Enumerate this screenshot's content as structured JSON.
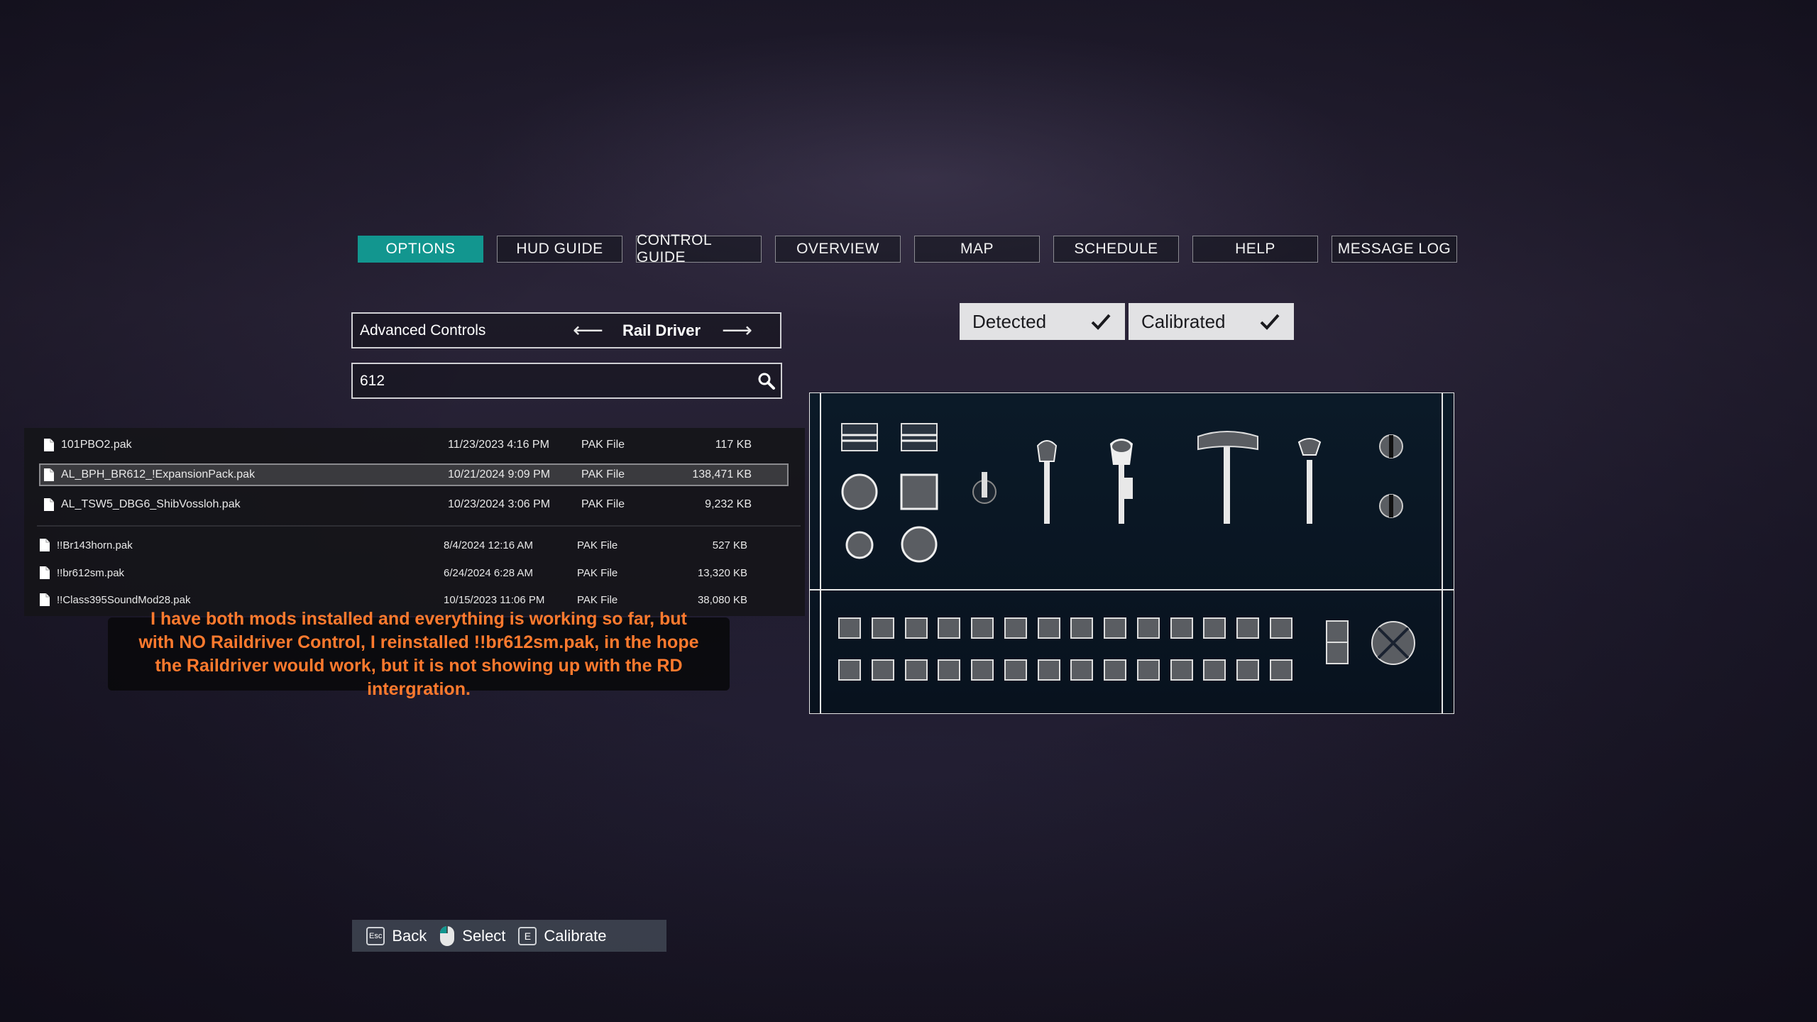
{
  "nav": {
    "tabs": [
      {
        "label": "OPTIONS",
        "active": true
      },
      {
        "label": "HUD GUIDE",
        "active": false
      },
      {
        "label": "CONTROL GUIDE",
        "active": false
      },
      {
        "label": "OVERVIEW",
        "active": false
      },
      {
        "label": "MAP",
        "active": false
      },
      {
        "label": "SCHEDULE",
        "active": false
      },
      {
        "label": "HELP",
        "active": false
      },
      {
        "label": "MESSAGE LOG",
        "active": false
      }
    ]
  },
  "selector": {
    "category": "Advanced Controls",
    "left_arrow": "⟵",
    "device": "Rail Driver",
    "right_arrow": "⟶"
  },
  "search": {
    "value": "612"
  },
  "status": {
    "detected": "Detected",
    "calibrated": "Calibrated"
  },
  "files": {
    "rows": [
      {
        "name": "101PBO2.pak",
        "date": "11/23/2023 4:16 PM",
        "type": "PAK File",
        "size": "117 KB"
      },
      {
        "name": "AL_BPH_BR612_!ExpansionPack.pak",
        "date": "10/21/2024 9:09 PM",
        "type": "PAK File",
        "size": "138,471 KB"
      },
      {
        "name": "AL_TSW5_DBG6_ShibVossloh.pak",
        "date": "10/23/2024 3:06 PM",
        "type": "PAK File",
        "size": "9,232 KB"
      },
      {
        "name": "!!Br143horn.pak",
        "date": "8/4/2024 12:16 AM",
        "type": "PAK File",
        "size": "527 KB"
      },
      {
        "name": "!!br612sm.pak",
        "date": "6/24/2024 6:28 AM",
        "type": "PAK File",
        "size": "13,320 KB"
      },
      {
        "name": "!!Class395SoundMod28.pak",
        "date": "10/15/2023 11:06 PM",
        "type": "PAK File",
        "size": "38,080 KB"
      }
    ]
  },
  "comment": {
    "line1": "I have both mods installed and everything is working so far, but",
    "line2": "with NO Raildriver Control, I reinstalled !!br612sm.pak, in the hope",
    "line3": "the Raildriver would work, but it is not showing up with the RD intergration."
  },
  "footer": {
    "back_key": "Esc",
    "back": "Back",
    "select": "Select",
    "calibrate_key": "E",
    "calibrate": "Calibrate"
  },
  "colors": {
    "accent": "#12968f",
    "comment_text": "#ff7a2e"
  }
}
